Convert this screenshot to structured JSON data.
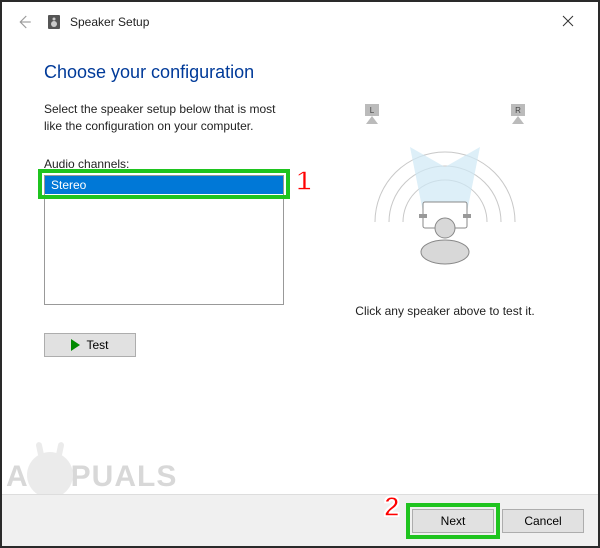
{
  "window": {
    "title": "Speaker Setup"
  },
  "content": {
    "heading": "Choose your configuration",
    "instruction": "Select the speaker setup below that is most like the configuration on your computer.",
    "channels_label": "Audio channels:",
    "channels_selected": "Stereo",
    "test_button": "Test",
    "tip": "Click any speaker above to test it.",
    "speaker_left_label": "L",
    "speaker_right_label": "R"
  },
  "buttons": {
    "next": "Next",
    "cancel": "Cancel"
  },
  "callouts": {
    "one": "1",
    "two": "2"
  },
  "watermark": {
    "part1": "A",
    "part2": "PUALS"
  }
}
